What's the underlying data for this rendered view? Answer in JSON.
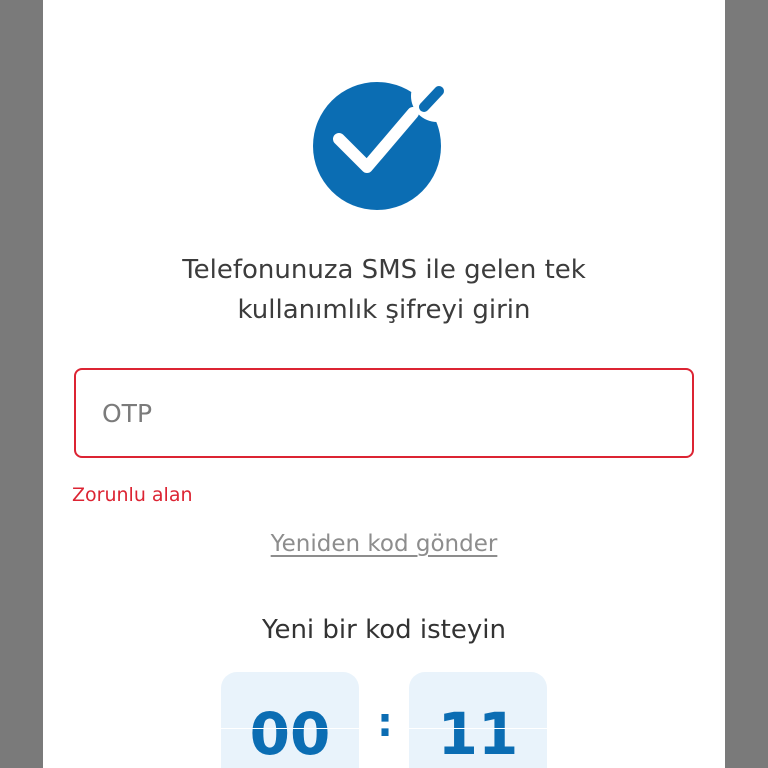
{
  "colors": {
    "accent": "#0b6db3",
    "error": "#dc2433",
    "timer_bg": "#e9f3fb",
    "backdrop": "#7a7a7a"
  },
  "icon": "checkmark-circle-icon",
  "instructions": {
    "line1": "Telefonunuza SMS ile gelen tek",
    "line2": "kullanımlık şifreyi girin"
  },
  "otp": {
    "placeholder": "OTP",
    "value": ""
  },
  "error_text": "Zorunlu alan",
  "resend_label": "Yeniden kod gönder",
  "countdown": {
    "title": "Yeni bir kod isteyin",
    "minutes": "00",
    "separator": ":",
    "seconds": "11"
  }
}
